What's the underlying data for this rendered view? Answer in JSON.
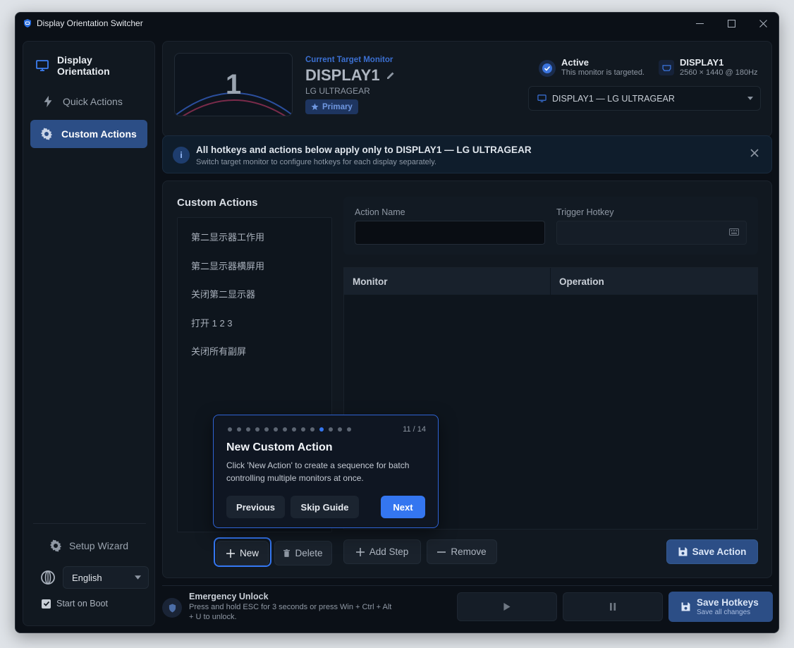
{
  "window": {
    "title": "Display Orientation Switcher"
  },
  "sidebar": {
    "header": "Display Orientation",
    "items": [
      {
        "label": "Quick Actions"
      },
      {
        "label": "Custom Actions"
      }
    ],
    "setup_wizard": "Setup Wizard",
    "language": "English",
    "start_on_boot": "Start on Boot",
    "start_on_boot_checked": true
  },
  "target": {
    "caption": "Current Target Monitor",
    "preview_number": "1",
    "name": "DISPLAY1",
    "model": "LG ULTRAGEAR",
    "badge": "Primary",
    "status_title": "Active",
    "status_sub": "This monitor is targeted.",
    "display_name": "DISPLAY1",
    "display_spec": "2560 × 1440 @ 180Hz",
    "selector_value": "DISPLAY1 — LG ULTRAGEAR"
  },
  "info": {
    "title": "All hotkeys and actions below apply only to DISPLAY1 — LG ULTRAGEAR",
    "subtitle": "Switch target monitor to configure hotkeys for each display separately."
  },
  "custom_actions": {
    "title": "Custom Actions",
    "items": [
      "第二显示器工作用",
      "第二显示器横屏用",
      "关闭第二显示器",
      "打开 1 2 3",
      "关闭所有副屏"
    ],
    "action_name_label": "Action Name",
    "action_name_value": "",
    "trigger_hotkey_label": "Trigger Hotkey",
    "trigger_hotkey_value": "",
    "table_headers": [
      "Monitor",
      "Operation"
    ],
    "new_label": "New",
    "delete_label": "Delete",
    "add_step_label": "Add Step",
    "remove_label": "Remove",
    "save_action_label": "Save Action"
  },
  "footer": {
    "emergency_title": "Emergency Unlock",
    "emergency_desc": "Press and hold ESC for 3 seconds or press Win + Ctrl + Alt + U to unlock.",
    "save_hotkeys_title": "Save Hotkeys",
    "save_hotkeys_sub": "Save all changes"
  },
  "guide": {
    "total_steps": 14,
    "current_step": 11,
    "step_label": "11 / 14",
    "title": "New Custom Action",
    "body": "Click 'New Action' to create a sequence for batch controlling multiple monitors at once.",
    "previous": "Previous",
    "skip": "Skip Guide",
    "next": "Next"
  },
  "colors": {
    "accent": "#3476f0",
    "active_nav": "#2c4e86",
    "window_bg": "#0b1017",
    "card_bg": "#111820"
  },
  "icons": {
    "app": "shield-monitor-icon",
    "display_orientation": "monitor-icon",
    "quick_actions": "lightning-icon",
    "custom_actions": "gear-icon",
    "setup_wizard": "gear-icon",
    "language": "globe-icon",
    "edit": "pencil-icon",
    "primary": "star-icon",
    "status": "check-circle-icon",
    "display": "hdmi-icon",
    "info": "info-icon",
    "keyboard": "keyboard-icon",
    "emergency": "shield-icon"
  }
}
